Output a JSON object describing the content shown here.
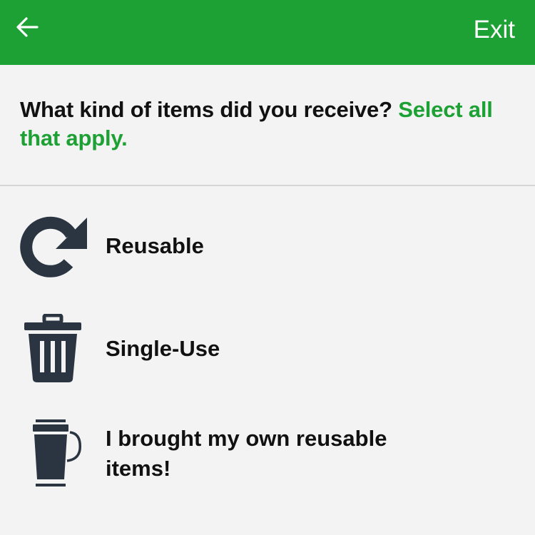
{
  "header": {
    "back_icon": "arrow-left-icon",
    "exit_label": "Exit",
    "background_color": "#1da134"
  },
  "question": {
    "prompt": "What kind of items did you receive?",
    "instruction": "Select all that apply."
  },
  "options": [
    {
      "icon": "refresh-icon",
      "label": "Reusable"
    },
    {
      "icon": "trash-can-icon",
      "label": "Single-Use"
    },
    {
      "icon": "travel-mug-icon",
      "label_line1": "I brought my own reusable",
      "label_line2": "items!"
    }
  ],
  "colors": {
    "accent": "#1da134",
    "icon": "#2b3542",
    "text": "#111111",
    "background": "#f3f3f3"
  }
}
